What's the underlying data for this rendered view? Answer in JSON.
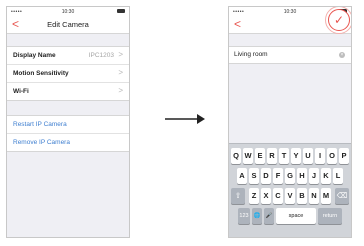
{
  "left": {
    "status": {
      "signal": "•••••",
      "time": "10:30"
    },
    "nav": {
      "back": "<",
      "title": "Edit Camera"
    },
    "rows": [
      {
        "label": "Display Name",
        "value": "IPC1203",
        "chevron": ">"
      },
      {
        "label": "Motion Sensitivity",
        "chevron": ">"
      },
      {
        "label": "Wi-Fi",
        "chevron": ">"
      }
    ],
    "actions": [
      {
        "label": "Restart IP Camera"
      },
      {
        "label": "Remove IP Camera"
      }
    ],
    "accent": "#e8544e",
    "link_color": "#3f7fd0"
  },
  "arrow": {
    "icon": "arrow-right-icon"
  },
  "right": {
    "status": {
      "signal": "•••••",
      "time": "10:30"
    },
    "nav": {
      "back": "<",
      "confirm": "✓"
    },
    "input": {
      "value": "Living room",
      "clear": "×"
    },
    "keyboard": {
      "row1": [
        "Q",
        "W",
        "E",
        "R",
        "T",
        "Y",
        "U",
        "I",
        "O",
        "P"
      ],
      "row2": [
        "A",
        "S",
        "D",
        "F",
        "G",
        "H",
        "J",
        "K",
        "L"
      ],
      "row3": [
        "Z",
        "X",
        "C",
        "V",
        "B",
        "N",
        "M"
      ],
      "shift": "⇧",
      "delete": "⌫",
      "numbers": "123",
      "globe": "🌐",
      "mic": "🎤",
      "space": "space",
      "return": "return"
    }
  }
}
